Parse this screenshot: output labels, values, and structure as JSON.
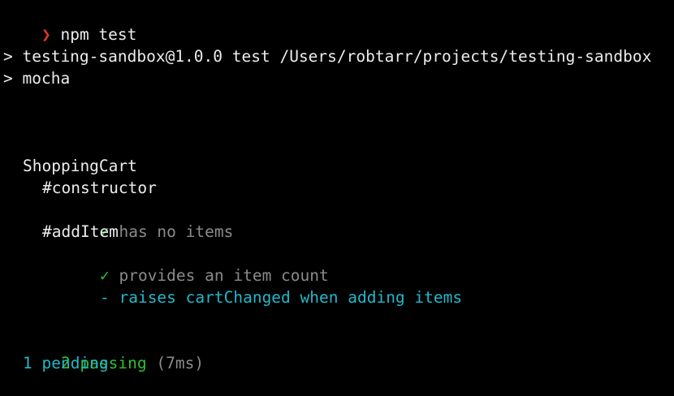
{
  "terminal": {
    "prompt_symbol": "❯",
    "command": "npm test",
    "script_line": "> testing-sandbox@1.0.0 test /Users/robtarr/projects/testing-sandbox",
    "runner_line": "> mocha",
    "suite": {
      "name": "ShoppingCart",
      "groups": [
        {
          "name": "#constructor",
          "tests": [
            {
              "status": "passed",
              "marker": "✓",
              "title": "has no items"
            }
          ]
        },
        {
          "name": "#addItem",
          "tests": [
            {
              "status": "passed",
              "marker": "✓",
              "title": "provides an item count"
            },
            {
              "status": "pending",
              "marker": "-",
              "title": "raises cartChanged when adding items"
            }
          ]
        }
      ]
    },
    "summary": {
      "passing_label": "2 passing",
      "duration": "(7ms)",
      "pending_label": "1 pending"
    }
  },
  "colors": {
    "background": "#000000",
    "text": "#ececec",
    "prompt": "#e0352b",
    "pass": "#2bc42b",
    "pending": "#22b8c9",
    "dim": "#8a8a8a"
  }
}
